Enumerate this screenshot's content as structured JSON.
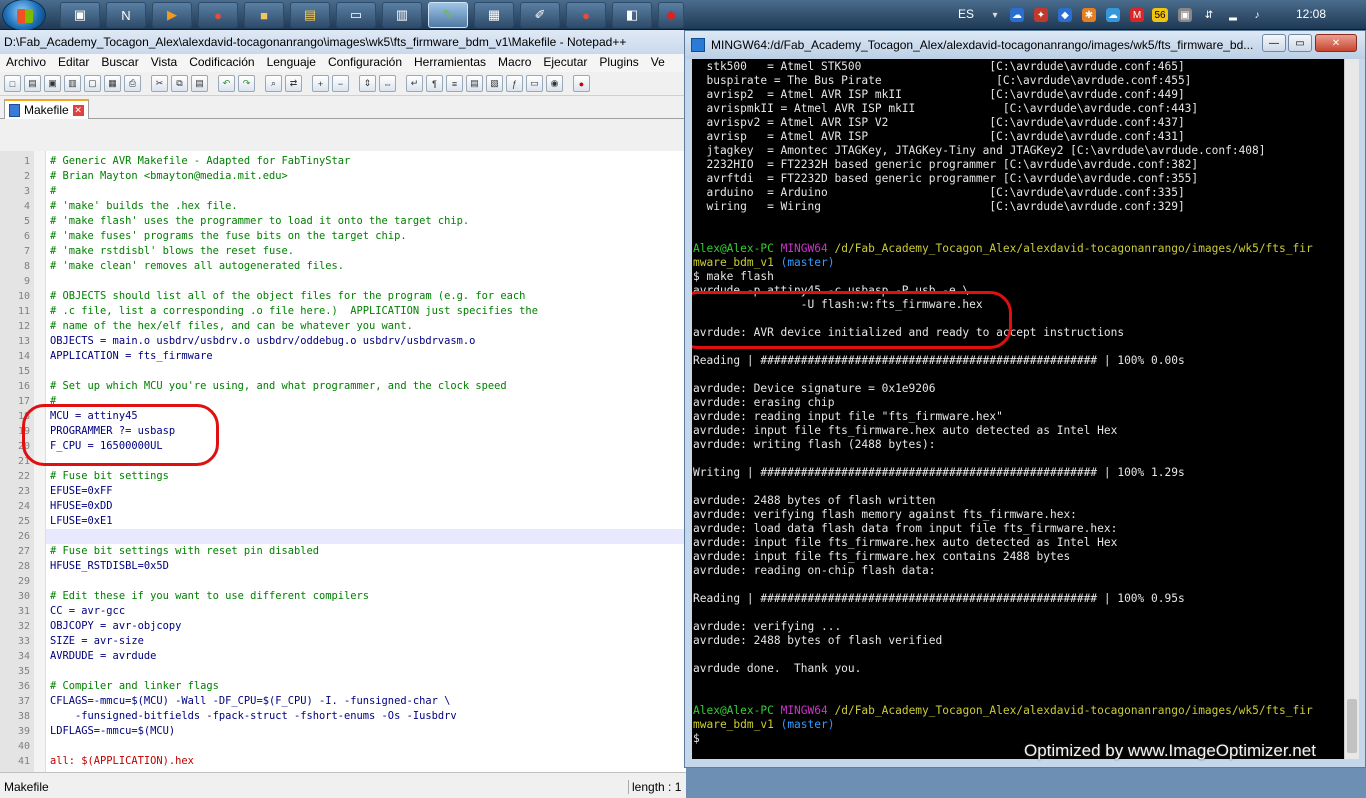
{
  "taskbar": {
    "language": "ES",
    "clock": "12:08",
    "tray_badge": "56",
    "apps": [
      "winrar",
      "notepad",
      "media",
      "chrome",
      "explorer",
      "folders",
      "remote",
      "notes",
      "notepadpp",
      "terminal",
      "editor",
      "chrome2",
      "pdf",
      "acrobat"
    ]
  },
  "npp": {
    "title": "D:\\Fab_Academy_Tocagon_Alex\\alexdavid-tocagonanrango\\images\\wk5\\fts_firmware_bdm_v1\\Makefile - Notepad++",
    "menu": [
      "Archivo",
      "Editar",
      "Buscar",
      "Vista",
      "Codificación",
      "Lenguaje",
      "Configuración",
      "Herramientas",
      "Macro",
      "Ejecutar",
      "Plugins",
      "Ve"
    ],
    "tab": "Makefile",
    "status_left": "Makefile",
    "status_right": "length : 1",
    "lines": [
      {
        "n": "1",
        "t": "# Generic AVR Makefile - Adapted for FabTinyStar",
        "k": "com"
      },
      {
        "n": "2",
        "t": "# Brian Mayton <bmayton@media.mit.edu>",
        "k": "com"
      },
      {
        "n": "3",
        "t": "#",
        "k": "com"
      },
      {
        "n": "4",
        "t": "# 'make' builds the .hex file.",
        "k": "com"
      },
      {
        "n": "5",
        "t": "# 'make flash' uses the programmer to load it onto the target chip.",
        "k": "com"
      },
      {
        "n": "6",
        "t": "# 'make fuses' programs the fuse bits on the target chip.",
        "k": "com"
      },
      {
        "n": "7",
        "t": "# 'make rstdisbl' blows the reset fuse.",
        "k": "com"
      },
      {
        "n": "8",
        "t": "# 'make clean' removes all autogenerated files.",
        "k": "com"
      },
      {
        "n": "9",
        "t": "",
        "k": ""
      },
      {
        "n": "10",
        "t": "# OBJECTS should list all of the object files for the program (e.g. for each",
        "k": "com"
      },
      {
        "n": "11",
        "t": "# .c file, list a corresponding .o file here.)  APPLICATION just specifies the",
        "k": "com"
      },
      {
        "n": "12",
        "t": "# name of the hex/elf files, and can be whatever you want.",
        "k": "com"
      },
      {
        "n": "13",
        "t": "OBJECTS = main.o usbdrv/usbdrv.o usbdrv/oddebug.o usbdrv/usbdrvasm.o",
        "k": "var"
      },
      {
        "n": "14",
        "t": "APPLICATION = fts_firmware",
        "k": "var"
      },
      {
        "n": "15",
        "t": "",
        "k": ""
      },
      {
        "n": "16",
        "t": "# Set up which MCU you're using, and what programmer, and the clock speed",
        "k": "com"
      },
      {
        "n": "17",
        "t": "#",
        "k": "com"
      },
      {
        "n": "18",
        "t": "MCU = attiny45",
        "k": "var"
      },
      {
        "n": "19",
        "t": "PROGRAMMER ?= usbasp",
        "k": "var"
      },
      {
        "n": "20",
        "t": "F_CPU = 16500000UL",
        "k": "var"
      },
      {
        "n": "21",
        "t": "",
        "k": ""
      },
      {
        "n": "22",
        "t": "# Fuse bit settings",
        "k": "com"
      },
      {
        "n": "23",
        "t": "EFUSE=0xFF",
        "k": "var"
      },
      {
        "n": "24",
        "t": "HFUSE=0xDD",
        "k": "var"
      },
      {
        "n": "25",
        "t": "LFUSE=0xE1",
        "k": "var"
      },
      {
        "n": "26",
        "t": "",
        "k": ""
      },
      {
        "n": "27",
        "t": "# Fuse bit settings with reset pin disabled",
        "k": "com"
      },
      {
        "n": "28",
        "t": "HFUSE_RSTDISBL=0x5D",
        "k": "var"
      },
      {
        "n": "29",
        "t": "",
        "k": ""
      },
      {
        "n": "30",
        "t": "# Edit these if you want to use different compilers",
        "k": "com"
      },
      {
        "n": "31",
        "t": "CC = avr-gcc",
        "k": "var"
      },
      {
        "n": "32",
        "t": "OBJCOPY = avr-objcopy",
        "k": "var"
      },
      {
        "n": "33",
        "t": "SIZE = avr-size",
        "k": "var"
      },
      {
        "n": "34",
        "t": "AVRDUDE = avrdude",
        "k": "var"
      },
      {
        "n": "35",
        "t": "",
        "k": ""
      },
      {
        "n": "36",
        "t": "# Compiler and linker flags",
        "k": "com"
      },
      {
        "n": "37",
        "t": "CFLAGS=-mmcu=$(MCU) -Wall -DF_CPU=$(F_CPU) -I. -funsigned-char \\",
        "k": "var"
      },
      {
        "n": "38",
        "t": "    -funsigned-bitfields -fpack-struct -fshort-enums -Os -Iusbdrv",
        "k": "var"
      },
      {
        "n": "39",
        "t": "LDFLAGS=-mmcu=$(MCU)",
        "k": "var"
      },
      {
        "n": "40",
        "t": "",
        "k": ""
      },
      {
        "n": "41",
        "t": "all: $(APPLICATION).hex",
        "k": "lbl"
      }
    ]
  },
  "terminal": {
    "title": "MINGW64:/d/Fab_Academy_Tocagon_Alex/alexdavid-tocagonanrango/images/wk5/fts_firmware_bd...",
    "lines": [
      {
        "t": "  stk500   = Atmel STK500                   [C:\\avrdude\\avrdude.conf:465]",
        "k": ""
      },
      {
        "t": "  buspirate = The Bus Pirate                 [C:\\avrdude\\avrdude.conf:455]",
        "k": ""
      },
      {
        "t": "  avrisp2  = Atmel AVR ISP mkII             [C:\\avrdude\\avrdude.conf:449]",
        "k": ""
      },
      {
        "t": "  avrispmkII = Atmel AVR ISP mkII             [C:\\avrdude\\avrdude.conf:443]",
        "k": ""
      },
      {
        "t": "  avrispv2 = Atmel AVR ISP V2               [C:\\avrdude\\avrdude.conf:437]",
        "k": ""
      },
      {
        "t": "  avrisp   = Atmel AVR ISP                  [C:\\avrdude\\avrdude.conf:431]",
        "k": ""
      },
      {
        "t": "  jtagkey  = Amontec JTAGKey, JTAGKey-Tiny and JTAGKey2 [C:\\avrdude\\avrdude.conf:408]",
        "k": ""
      },
      {
        "t": "  2232HIO  = FT2232H based generic programmer [C:\\avrdude\\avrdude.conf:382]",
        "k": ""
      },
      {
        "t": "  avrftdi  = FT2232D based generic programmer [C:\\avrdude\\avrdude.conf:355]",
        "k": ""
      },
      {
        "t": "  arduino  = Arduino                        [C:\\avrdude\\avrdude.conf:335]",
        "k": ""
      },
      {
        "t": "  wiring   = Wiring                         [C:\\avrdude\\avrdude.conf:329]",
        "k": ""
      },
      {
        "t": "",
        "k": ""
      },
      {
        "t": "",
        "k": ""
      },
      {
        "t": "",
        "k": "prompt1"
      },
      {
        "t": "",
        "k": "prompt1b"
      },
      {
        "t": "$ make flash",
        "k": ""
      },
      {
        "t": "avrdude -p attiny45 -c usbasp -P usb -e \\",
        "k": ""
      },
      {
        "t": "                -U flash:w:fts_firmware.hex",
        "k": ""
      },
      {
        "t": "",
        "k": ""
      },
      {
        "t": "avrdude: AVR device initialized and ready to accept instructions",
        "k": ""
      },
      {
        "t": "",
        "k": ""
      },
      {
        "t": "Reading | ################################################## | 100% 0.00s",
        "k": ""
      },
      {
        "t": "",
        "k": ""
      },
      {
        "t": "avrdude: Device signature = 0x1e9206",
        "k": ""
      },
      {
        "t": "avrdude: erasing chip",
        "k": ""
      },
      {
        "t": "avrdude: reading input file \"fts_firmware.hex\"",
        "k": ""
      },
      {
        "t": "avrdude: input file fts_firmware.hex auto detected as Intel Hex",
        "k": ""
      },
      {
        "t": "avrdude: writing flash (2488 bytes):",
        "k": ""
      },
      {
        "t": "",
        "k": ""
      },
      {
        "t": "Writing | ################################################## | 100% 1.29s",
        "k": ""
      },
      {
        "t": "",
        "k": ""
      },
      {
        "t": "avrdude: 2488 bytes of flash written",
        "k": ""
      },
      {
        "t": "avrdude: verifying flash memory against fts_firmware.hex:",
        "k": ""
      },
      {
        "t": "avrdude: load data flash data from input file fts_firmware.hex:",
        "k": ""
      },
      {
        "t": "avrdude: input file fts_firmware.hex auto detected as Intel Hex",
        "k": ""
      },
      {
        "t": "avrdude: input file fts_firmware.hex contains 2488 bytes",
        "k": ""
      },
      {
        "t": "avrdude: reading on-chip flash data:",
        "k": ""
      },
      {
        "t": "",
        "k": ""
      },
      {
        "t": "Reading | ################################################## | 100% 0.95s",
        "k": ""
      },
      {
        "t": "",
        "k": ""
      },
      {
        "t": "avrdude: verifying ...",
        "k": ""
      },
      {
        "t": "avrdude: 2488 bytes of flash verified",
        "k": ""
      },
      {
        "t": "",
        "k": ""
      },
      {
        "t": "avrdude done.  Thank you.",
        "k": ""
      },
      {
        "t": "",
        "k": ""
      },
      {
        "t": "",
        "k": ""
      },
      {
        "t": "",
        "k": "prompt2"
      },
      {
        "t": "",
        "k": "prompt2b"
      },
      {
        "t": "$",
        "k": ""
      }
    ],
    "prompt1": {
      "user": "Alex@Alex-PC",
      "sys": "MINGW64",
      "path": "/d/Fab_Academy_Tocagon_Alex/alexdavid-tocagonanrango/images/wk5/fts_fir",
      "path2": "mware_bdm_v1",
      "branch": "(master)"
    },
    "prompt2": {
      "user": "Alex@Alex-PC",
      "sys": "MINGW64",
      "path": "/d/Fab_Academy_Tocagon_Alex/alexdavid-tocagonanrango/images/wk5/fts_fir",
      "path2": "mware_bdm_v1",
      "branch": "(master)"
    }
  },
  "watermark": "Optimized by www.ImageOptimizer.net"
}
